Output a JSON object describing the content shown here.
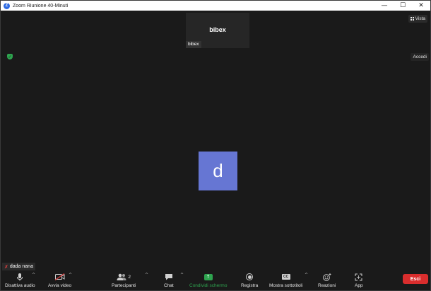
{
  "window": {
    "title": "Zoom Riunione 40-Minuti",
    "app_icon": "zoom-logo-icon",
    "controls": {
      "minimize": "—",
      "maximize": "☐",
      "close": "✕"
    }
  },
  "top": {
    "participant_tile": {
      "name": "bibex",
      "tag": "bibex"
    },
    "view_button": "Vista",
    "signin_button": "Accedi",
    "security_icon": "shield-check-icon"
  },
  "main": {
    "avatar_letter": "d",
    "avatar_color": "#6676d3",
    "self_name": "dada nana"
  },
  "toolbar": {
    "mute": {
      "label": "Disattiva audio",
      "icon": "microphone-icon"
    },
    "video": {
      "label": "Avvia video",
      "icon": "video-off-icon"
    },
    "participants": {
      "label": "Partecipanti",
      "count": "2",
      "icon": "participants-icon"
    },
    "chat": {
      "label": "Chat",
      "icon": "chat-icon"
    },
    "share": {
      "label": "Condividi schermo",
      "icon": "share-screen-icon",
      "color": "#2ea44f"
    },
    "record": {
      "label": "Registra",
      "icon": "record-icon"
    },
    "captions": {
      "label": "Mostra sottotitoli",
      "icon": "cc-icon",
      "badge": "CC"
    },
    "reactions": {
      "label": "Reazioni",
      "icon": "reactions-icon"
    },
    "apps": {
      "label": "App",
      "icon": "apps-icon"
    },
    "leave": {
      "label": "Esci",
      "color": "#d92d2d"
    }
  }
}
